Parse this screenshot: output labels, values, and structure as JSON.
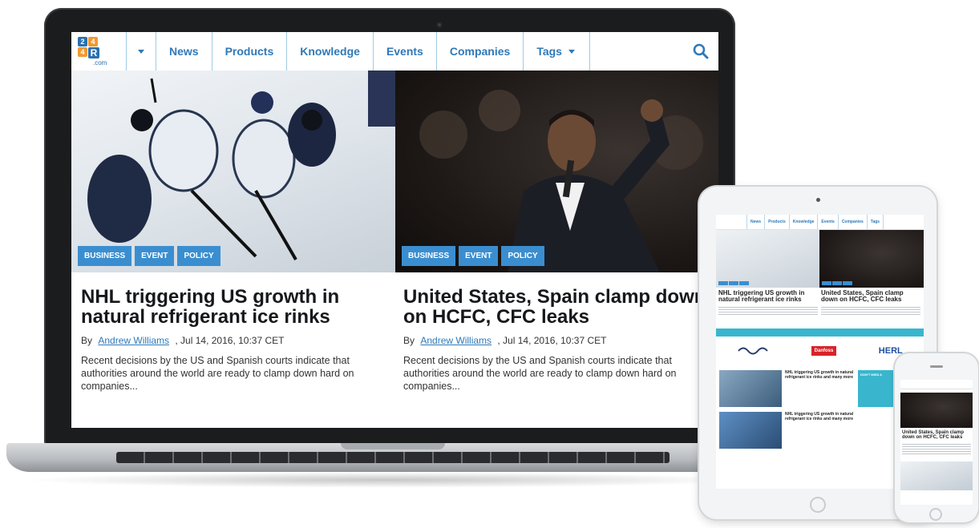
{
  "nav": {
    "logo_digits": [
      "2",
      "4",
      "4"
    ],
    "logo_letter": "R",
    "logo_suffix": ".com",
    "items": [
      "News",
      "Products",
      "Knowledge",
      "Events",
      "Companies",
      "Tags"
    ]
  },
  "articles": [
    {
      "tags": [
        "BUSINESS",
        "EVENT",
        "POLICY"
      ],
      "title": "NHL triggering US growth in natural refrigerant ice rinks",
      "by_label": "By",
      "author": "Andrew Williams",
      "date": ", Jul 14, 2016, 10:37 CET",
      "excerpt": "Recent decisions by the US and Spanish courts indicate that authorities around the world are ready to clamp down hard on companies..."
    },
    {
      "tags": [
        "BUSINESS",
        "EVENT",
        "POLICY"
      ],
      "title": "United States, Spain clamp down on HCFC, CFC leaks",
      "by_label": "By",
      "author": "Andrew Williams",
      "date": ", Jul 14, 2016, 10:37 CET",
      "excerpt": "Recent decisions by the US and Spanish courts indicate that authorities around the world are ready to clamp down hard on companies..."
    }
  ],
  "tablet": {
    "nav_items": [
      "News",
      "Products",
      "Knowledge",
      "Events",
      "Companies",
      "Tags"
    ],
    "headlines": [
      "NHL triggering US growth in natural refrigerant ice rinks",
      "United States, Spain clamp down on HCFC, CFC leaks"
    ],
    "banner": "",
    "sponsor_logos": [
      "Danfoss",
      "HERL"
    ],
    "side_button": "DON'T MISS A",
    "row_titles": [
      "NHL triggering US growth in natural refrigerant ice rinks and many more",
      "NHL triggering US growth in natural refrigerant ice rinks and many more"
    ]
  },
  "phone": {
    "headline": "United States, Spain clamp down on HCFC, CFC leaks"
  },
  "colors": {
    "accent": "#2f79b8",
    "tag": "#3a8ed0",
    "banner": "#39b6cd",
    "logo_blue": "#2a6fb0",
    "logo_orange": "#f29a2e"
  }
}
